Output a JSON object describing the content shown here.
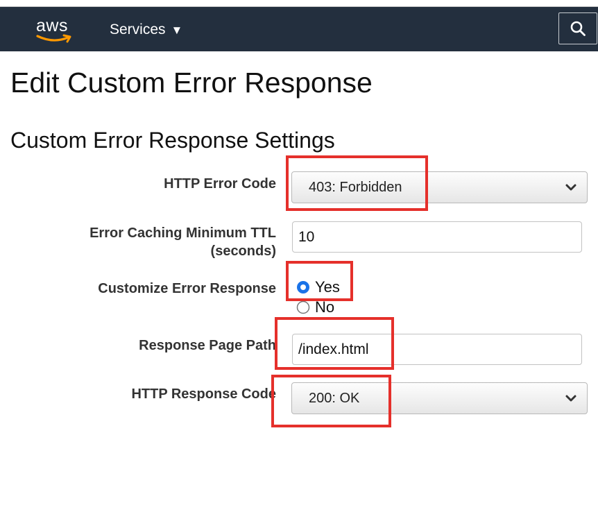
{
  "navbar": {
    "logo_text": "aws",
    "services_label": "Services",
    "services_caret": "▼",
    "search_icon": "search-icon"
  },
  "page": {
    "title": "Edit Custom Error Response",
    "section_title": "Custom Error Response Settings"
  },
  "form": {
    "http_error_code": {
      "label": "HTTP Error Code",
      "value": "403: Forbidden"
    },
    "error_caching_ttl": {
      "label_line1": "Error Caching Minimum TTL",
      "label_line2": "(seconds)",
      "value": "10"
    },
    "customize_error_response": {
      "label": "Customize Error Response",
      "options": [
        {
          "label": "Yes",
          "checked": true
        },
        {
          "label": "No",
          "checked": false
        }
      ]
    },
    "response_page_path": {
      "label": "Response Page Path",
      "value": "/index.html"
    },
    "http_response_code": {
      "label": "HTTP Response Code",
      "value": "200: OK"
    }
  },
  "colors": {
    "navbar_bg": "#232f3e",
    "aws_orange": "#ff9900",
    "highlight_red": "#e5302b",
    "radio_blue": "#1a73e8"
  }
}
